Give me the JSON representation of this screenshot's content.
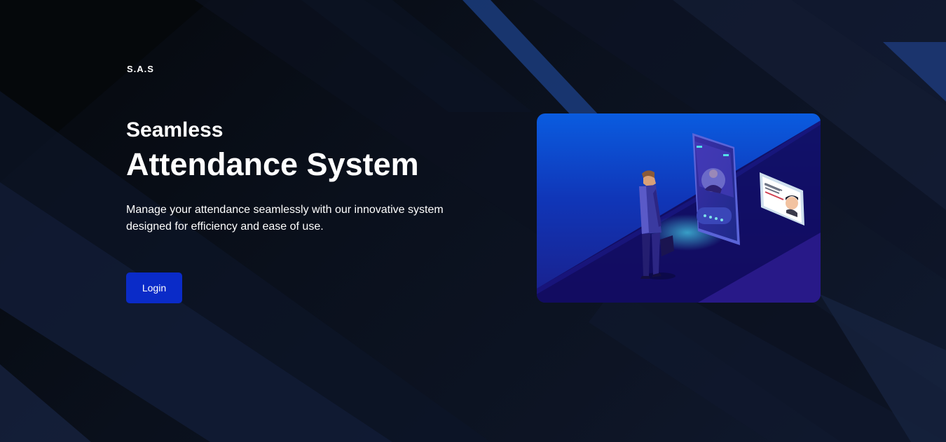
{
  "brand": {
    "name": "S.A.S"
  },
  "hero": {
    "subtitle": "Seamless",
    "title": "Attendance System",
    "description": "Manage your attendance seamlessly with our innovative system designed for efficiency and ease of use.",
    "login_label": "Login",
    "illustration_icon": "face-recognition-illustration"
  },
  "colors": {
    "background": "#0a0f1a",
    "accent": "#0a2bc8",
    "text": "#ffffff",
    "illustration_bg": "#1030c0"
  }
}
